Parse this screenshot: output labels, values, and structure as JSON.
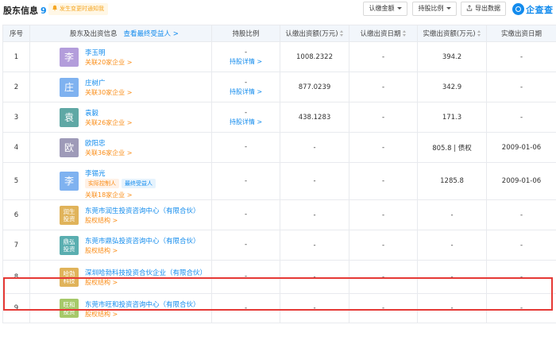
{
  "header": {
    "title": "股东信息",
    "count": "9",
    "notice": "发生变更时通知我",
    "filter_amount": "认缴金额",
    "filter_ratio": "持股比例",
    "export": "导出数据",
    "brand": "企查查"
  },
  "columns": {
    "index": "序号",
    "holder": "股东及出资信息",
    "final_beneficiary_link": "查看最终受益人 >",
    "ratio": "持股比例",
    "subscribed_amount": "认缴出资额(万元)",
    "subscribed_date": "认缴出资日期",
    "paid_amount": "实缴出资额(万元)",
    "paid_date": "实缴出资日期"
  },
  "rows": [
    {
      "index": "1",
      "avatar": "李",
      "avatar_color": "#b39ddb",
      "name": "李玉明",
      "sub": "关联20家企业 >",
      "ratio": "-",
      "ratio_link": "持股详情 >",
      "subscribed_amount": "1008.2322",
      "subscribed_date": "-",
      "paid_amount": "394.2",
      "paid_date": "-"
    },
    {
      "index": "2",
      "avatar": "庄",
      "avatar_color": "#7fb2f0",
      "name": "庄树广",
      "sub": "关联30家企业 >",
      "ratio": "-",
      "ratio_link": "持股详情 >",
      "subscribed_amount": "877.0239",
      "subscribed_date": "-",
      "paid_amount": "342.9",
      "paid_date": "-"
    },
    {
      "index": "3",
      "avatar": "袁",
      "avatar_color": "#5fa8a5",
      "name": "袁毅",
      "sub": "关联26家企业 >",
      "ratio": "-",
      "ratio_link": "持股详情 >",
      "subscribed_amount": "438.1283",
      "subscribed_date": "-",
      "paid_amount": "171.3",
      "paid_date": "-"
    },
    {
      "index": "4",
      "avatar": "欧",
      "avatar_color": "#9e9ab8",
      "name": "欧阳忠",
      "sub": "关联36家企业 >",
      "ratio": "-",
      "ratio_link": "",
      "subscribed_amount": "-",
      "subscribed_date": "-",
      "paid_amount": "805.8 | 债权",
      "paid_date": "2009-01-06"
    },
    {
      "index": "5",
      "avatar": "李",
      "avatar_color": "#7fb2f0",
      "name": "李锡光",
      "tags": [
        "实际控制人",
        "最终受益人"
      ],
      "sub": "关联18家企业 >",
      "ratio": "-",
      "ratio_link": "",
      "subscribed_amount": "-",
      "subscribed_date": "-",
      "paid_amount": "1285.8",
      "paid_date": "2009-01-06"
    },
    {
      "index": "6",
      "avatar": "润生投资",
      "avatar_color": "#e0b35a",
      "name": "东莞市润生投资咨询中心（有限合伙）",
      "sub": "股权结构 >",
      "ratio": "-",
      "ratio_link": "",
      "subscribed_amount": "-",
      "subscribed_date": "-",
      "paid_amount": "-",
      "paid_date": "-"
    },
    {
      "index": "7",
      "avatar": "鼎弘投资",
      "avatar_color": "#5aaeb0",
      "name": "东莞市鼎弘投资咨询中心（有限合伙）",
      "sub": "股权结构 >",
      "ratio": "-",
      "ratio_link": "",
      "subscribed_amount": "-",
      "subscribed_date": "-",
      "paid_amount": "-",
      "paid_date": "-"
    },
    {
      "index": "8",
      "avatar": "哈勃科技",
      "avatar_color": "#e0b35a",
      "name": "深圳哈勃科技投资合伙企业（有限合伙）",
      "sub": "股权结构 >",
      "ratio": "-",
      "ratio_link": "",
      "subscribed_amount": "-",
      "subscribed_date": "-",
      "paid_amount": "-",
      "paid_date": "-"
    },
    {
      "index": "9",
      "avatar": "旺和投资",
      "avatar_color": "#a6c96a",
      "name": "东莞市旺和投资咨询中心（有限合伙）",
      "sub": "股权结构 >",
      "ratio": "-",
      "ratio_link": "",
      "subscribed_amount": "-",
      "subscribed_date": "-",
      "paid_amount": "-",
      "paid_date": "-"
    }
  ],
  "highlight_row_index": "8",
  "colors": {
    "link": "#128bed",
    "orange": "#fa8c16",
    "highlight": "#e53935",
    "header_bg": "#f2f6fb"
  }
}
